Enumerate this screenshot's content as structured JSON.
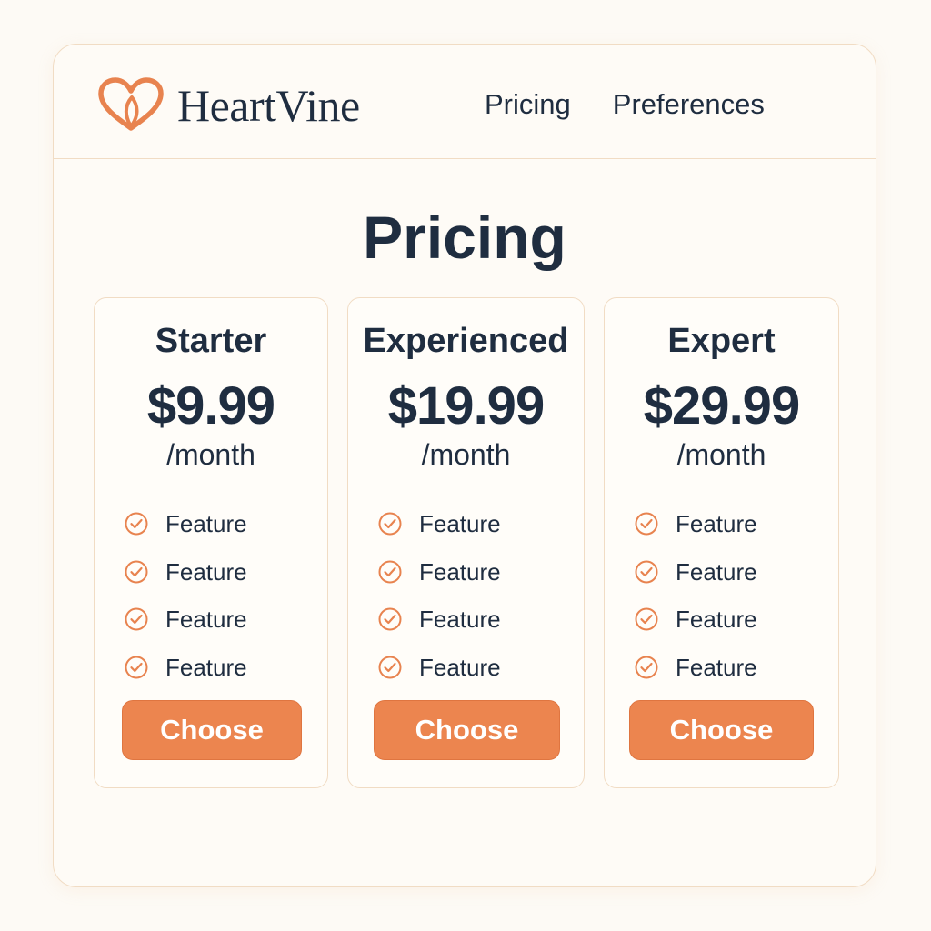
{
  "app": {
    "brand": "HeartVine",
    "logo_icon": "heart-leaf-icon",
    "accent_color": "#ec854f",
    "text_color": "#1f2d40",
    "border_color": "#f1dcc4"
  },
  "nav": {
    "items": [
      {
        "label": "Pricing"
      },
      {
        "label": "Preferences"
      }
    ]
  },
  "main": {
    "title": "Pricing",
    "plans": [
      {
        "name": "Starter",
        "price": "$9.99",
        "period": "/month",
        "features": [
          "Feature",
          "Feature",
          "Feature",
          "Feature"
        ],
        "button_label": "Choose"
      },
      {
        "name": "Experienced",
        "price": "$19.99",
        "period": "/month",
        "features": [
          "Feature",
          "Feature",
          "Feature",
          "Feature"
        ],
        "button_label": "Choose"
      },
      {
        "name": "Expert",
        "price": "$29.99",
        "period": "/month",
        "features": [
          "Feature",
          "Feature",
          "Feature",
          "Feature"
        ],
        "button_label": "Choose"
      }
    ]
  },
  "icons": {
    "feature_check": "check-circle-icon"
  }
}
